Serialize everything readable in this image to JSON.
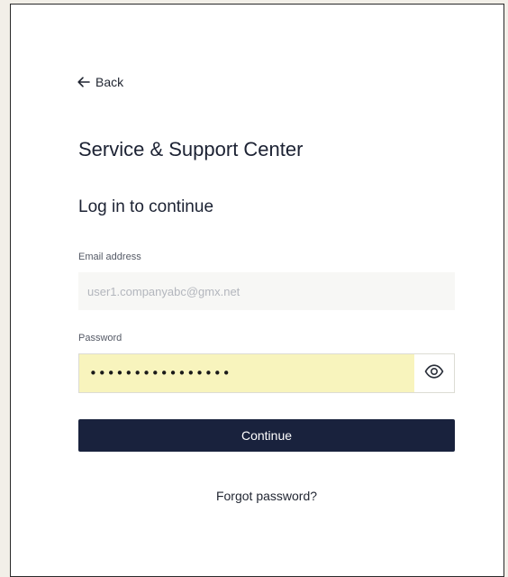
{
  "nav": {
    "back_label": "Back"
  },
  "header": {
    "title": "Service & Support Center",
    "subtitle": "Log in to continue"
  },
  "form": {
    "email": {
      "label": "Email address",
      "value": "user1.companyabc@gmx.net"
    },
    "password": {
      "label": "Password",
      "value": "••••••••••••••••"
    },
    "continue_label": "Continue",
    "forgot_label": "Forgot password?"
  },
  "icons": {
    "back": "arrow-left-icon",
    "toggle": "eye-icon"
  },
  "colors": {
    "primary_button": "#19223d",
    "autofill_background": "#f8f4bd",
    "page_background": "#f2efe8"
  }
}
